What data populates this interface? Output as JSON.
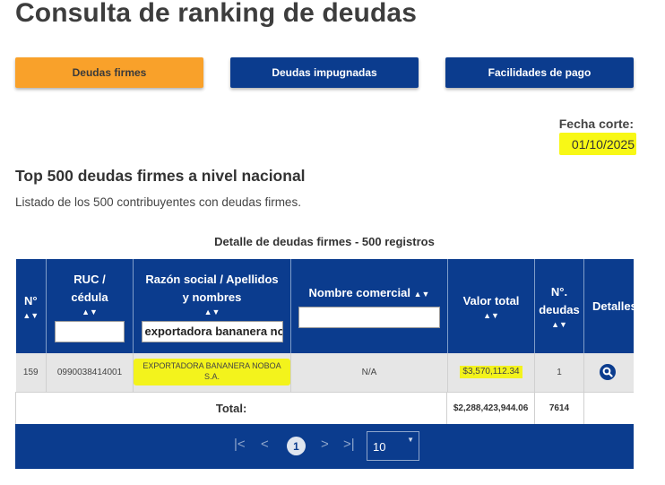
{
  "page": {
    "title": "Consulta de ranking de deudas"
  },
  "tabs": [
    {
      "label": "Deudas firmes",
      "active": true
    },
    {
      "label": "Deudas impugnadas",
      "active": false
    },
    {
      "label": "Facilidades de pago",
      "active": false
    }
  ],
  "fecha": {
    "label": "Fecha corte:",
    "value": "01/10/2025"
  },
  "section": {
    "title": "Top 500 deudas firmes a nivel nacional",
    "description": "Listado de los 500 contribuyentes con deudas firmes.",
    "caption": "Detalle de deudas firmes - 500 registros"
  },
  "table": {
    "headers": {
      "n": "N°",
      "ruc": "RUC / cédula",
      "razon": "Razón social / Apellidos y nombres",
      "comercial": "Nombre comercial",
      "valor": "Valor total",
      "deudas": "N°. deudas",
      "detalles": "Detalles"
    },
    "filters": {
      "ruc": "",
      "razon": "exportadora bananera noboa",
      "comercial": ""
    },
    "rows": [
      {
        "n": "159",
        "ruc": "0990038414001",
        "razon": "EXPORTADORA BANANERA NOBOA S.A.",
        "comercial": "N/A",
        "valor": "$3,570,112.34",
        "deudas": "1"
      }
    ],
    "total": {
      "label": "Total:",
      "valor": "$2,288,423,944.06",
      "deudas": "7614"
    }
  },
  "pager": {
    "current_page": "1",
    "page_size": "10"
  },
  "colors": {
    "primary": "#0b3c8e",
    "accent": "#f9a12a",
    "highlight": "#f3f31c"
  }
}
